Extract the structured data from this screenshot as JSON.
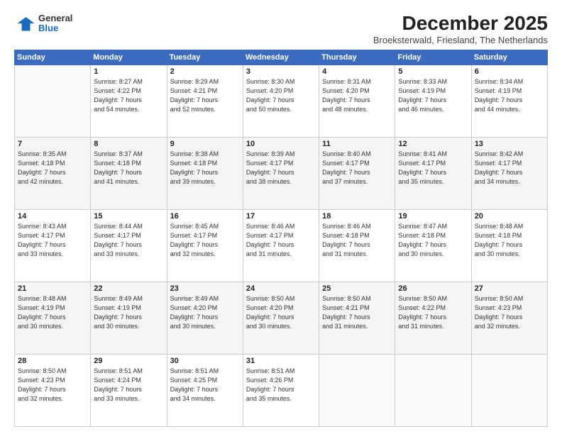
{
  "logo": {
    "general": "General",
    "blue": "Blue"
  },
  "title": "December 2025",
  "subtitle": "Broeksterwald, Friesland, The Netherlands",
  "header_days": [
    "Sunday",
    "Monday",
    "Tuesday",
    "Wednesday",
    "Thursday",
    "Friday",
    "Saturday"
  ],
  "weeks": [
    [
      {
        "day": "",
        "info": ""
      },
      {
        "day": "1",
        "info": "Sunrise: 8:27 AM\nSunset: 4:22 PM\nDaylight: 7 hours\nand 54 minutes."
      },
      {
        "day": "2",
        "info": "Sunrise: 8:29 AM\nSunset: 4:21 PM\nDaylight: 7 hours\nand 52 minutes."
      },
      {
        "day": "3",
        "info": "Sunrise: 8:30 AM\nSunset: 4:20 PM\nDaylight: 7 hours\nand 50 minutes."
      },
      {
        "day": "4",
        "info": "Sunrise: 8:31 AM\nSunset: 4:20 PM\nDaylight: 7 hours\nand 48 minutes."
      },
      {
        "day": "5",
        "info": "Sunrise: 8:33 AM\nSunset: 4:19 PM\nDaylight: 7 hours\nand 46 minutes."
      },
      {
        "day": "6",
        "info": "Sunrise: 8:34 AM\nSunset: 4:19 PM\nDaylight: 7 hours\nand 44 minutes."
      }
    ],
    [
      {
        "day": "7",
        "info": "Sunrise: 8:35 AM\nSunset: 4:18 PM\nDaylight: 7 hours\nand 42 minutes."
      },
      {
        "day": "8",
        "info": "Sunrise: 8:37 AM\nSunset: 4:18 PM\nDaylight: 7 hours\nand 41 minutes."
      },
      {
        "day": "9",
        "info": "Sunrise: 8:38 AM\nSunset: 4:18 PM\nDaylight: 7 hours\nand 39 minutes."
      },
      {
        "day": "10",
        "info": "Sunrise: 8:39 AM\nSunset: 4:17 PM\nDaylight: 7 hours\nand 38 minutes."
      },
      {
        "day": "11",
        "info": "Sunrise: 8:40 AM\nSunset: 4:17 PM\nDaylight: 7 hours\nand 37 minutes."
      },
      {
        "day": "12",
        "info": "Sunrise: 8:41 AM\nSunset: 4:17 PM\nDaylight: 7 hours\nand 35 minutes."
      },
      {
        "day": "13",
        "info": "Sunrise: 8:42 AM\nSunset: 4:17 PM\nDaylight: 7 hours\nand 34 minutes."
      }
    ],
    [
      {
        "day": "14",
        "info": "Sunrise: 8:43 AM\nSunset: 4:17 PM\nDaylight: 7 hours\nand 33 minutes."
      },
      {
        "day": "15",
        "info": "Sunrise: 8:44 AM\nSunset: 4:17 PM\nDaylight: 7 hours\nand 33 minutes."
      },
      {
        "day": "16",
        "info": "Sunrise: 8:45 AM\nSunset: 4:17 PM\nDaylight: 7 hours\nand 32 minutes."
      },
      {
        "day": "17",
        "info": "Sunrise: 8:46 AM\nSunset: 4:17 PM\nDaylight: 7 hours\nand 31 minutes."
      },
      {
        "day": "18",
        "info": "Sunrise: 8:46 AM\nSunset: 4:18 PM\nDaylight: 7 hours\nand 31 minutes."
      },
      {
        "day": "19",
        "info": "Sunrise: 8:47 AM\nSunset: 4:18 PM\nDaylight: 7 hours\nand 30 minutes."
      },
      {
        "day": "20",
        "info": "Sunrise: 8:48 AM\nSunset: 4:18 PM\nDaylight: 7 hours\nand 30 minutes."
      }
    ],
    [
      {
        "day": "21",
        "info": "Sunrise: 8:48 AM\nSunset: 4:19 PM\nDaylight: 7 hours\nand 30 minutes."
      },
      {
        "day": "22",
        "info": "Sunrise: 8:49 AM\nSunset: 4:19 PM\nDaylight: 7 hours\nand 30 minutes."
      },
      {
        "day": "23",
        "info": "Sunrise: 8:49 AM\nSunset: 4:20 PM\nDaylight: 7 hours\nand 30 minutes."
      },
      {
        "day": "24",
        "info": "Sunrise: 8:50 AM\nSunset: 4:20 PM\nDaylight: 7 hours\nand 30 minutes."
      },
      {
        "day": "25",
        "info": "Sunrise: 8:50 AM\nSunset: 4:21 PM\nDaylight: 7 hours\nand 31 minutes."
      },
      {
        "day": "26",
        "info": "Sunrise: 8:50 AM\nSunset: 4:22 PM\nDaylight: 7 hours\nand 31 minutes."
      },
      {
        "day": "27",
        "info": "Sunrise: 8:50 AM\nSunset: 4:23 PM\nDaylight: 7 hours\nand 32 minutes."
      }
    ],
    [
      {
        "day": "28",
        "info": "Sunrise: 8:50 AM\nSunset: 4:23 PM\nDaylight: 7 hours\nand 32 minutes."
      },
      {
        "day": "29",
        "info": "Sunrise: 8:51 AM\nSunset: 4:24 PM\nDaylight: 7 hours\nand 33 minutes."
      },
      {
        "day": "30",
        "info": "Sunrise: 8:51 AM\nSunset: 4:25 PM\nDaylight: 7 hours\nand 34 minutes."
      },
      {
        "day": "31",
        "info": "Sunrise: 8:51 AM\nSunset: 4:26 PM\nDaylight: 7 hours\nand 35 minutes."
      },
      {
        "day": "",
        "info": ""
      },
      {
        "day": "",
        "info": ""
      },
      {
        "day": "",
        "info": ""
      }
    ]
  ]
}
